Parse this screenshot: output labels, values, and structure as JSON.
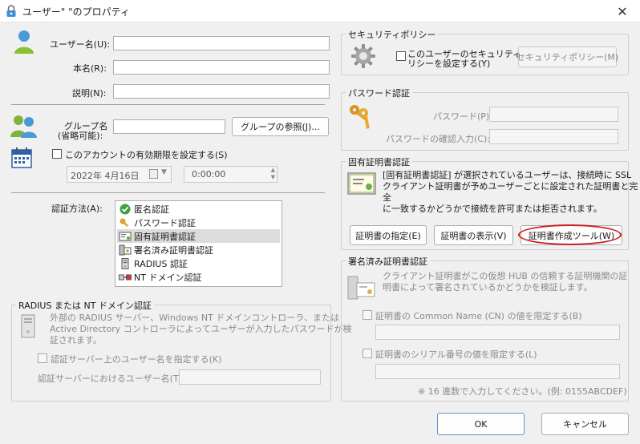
{
  "window": {
    "title": "ユーザー\" \"のプロパティ",
    "close_glyph": "✕"
  },
  "user": {
    "username_label": "ユーザー名(U):",
    "username_value": "",
    "realname_label": "本名(R):",
    "realname_value": "",
    "description_label": "説明(N):",
    "description_value": ""
  },
  "group": {
    "label_line1": "グループ名",
    "label_line2": "(省略可能):",
    "value": "",
    "browse_button": "グループの参照(J)..."
  },
  "expiry": {
    "checkbox_label": "このアカウントの有効期限を設定する(S)",
    "date_value": "2022年  4月16日",
    "time_value": "0:00:00"
  },
  "auth": {
    "label": "認証方法(A):",
    "methods": [
      {
        "label": "匿名認証",
        "icon": "check-circle-icon"
      },
      {
        "label": "パスワード認証",
        "icon": "key-icon"
      },
      {
        "label": "固有証明書認証",
        "icon": "certificate-icon"
      },
      {
        "label": "署名済み証明書認証",
        "icon": "signed-certificate-icon"
      },
      {
        "label": "RADIUS 認証",
        "icon": "server-icon"
      },
      {
        "label": "NT ドメイン認証",
        "icon": "network-icon"
      }
    ],
    "selected_index": 2
  },
  "radius": {
    "group_title": "RADIUS または NT ドメイン認証",
    "desc_line1": "外部の RADIUS サーバー、Windows NT ドメインコントローラ、または",
    "desc_line2": "Active Directory コントローラによってユーザーが入力したパスワードが検",
    "desc_line3": "証されます。",
    "checkbox_label": "認証サーバー上のユーザー名を指定する(K)",
    "server_username_label": "認証サーバーにおけるユーザー名(T):",
    "server_username_value": ""
  },
  "security": {
    "group_title": "セキュリティポリシー",
    "checkbox_line1": "このユーザーのセキュリティポ",
    "checkbox_line2": "リシーを設定する(Y)",
    "button": "セキュリティポリシー(M)"
  },
  "password": {
    "group_title": "パスワード認証",
    "password_label": "パスワード(P):",
    "password_value": "",
    "confirm_label": "パスワードの確認入力(C):",
    "confirm_value": ""
  },
  "cert": {
    "group_title": "固有証明書認証",
    "desc_line1": "[固有証明書認証] が選択されているユーザーは、接続時に SSL",
    "desc_line2": "クライアント証明書が予めユーザーごとに設定された証明書と完全",
    "desc_line3": "に一致するかどうかで接続を許可または拒否されます。",
    "specify_button": "証明書の指定(E)",
    "view_button": "証明書の表示(V)",
    "create_button": "証明書作成ツール(W)",
    "highlight_color": "#cc1f1f"
  },
  "signed": {
    "group_title": "署名済み証明書認証",
    "desc_line1": "クライアント証明書がこの仮想 HUB の信頼する証明機関の証",
    "desc_line2": "明書によって署名されているかどうかを検証します。",
    "cn_checkbox_label": "証明書の Common Name (CN) の値を限定する(B)",
    "cn_value": "",
    "serial_checkbox_label": "証明書のシリアル番号の値を限定する(L)",
    "serial_value": "",
    "note": "※ 16 進数で入力してください。(例: 0155ABCDEF)"
  },
  "footer": {
    "ok_button": "OK",
    "cancel_button": "キャンセル"
  }
}
